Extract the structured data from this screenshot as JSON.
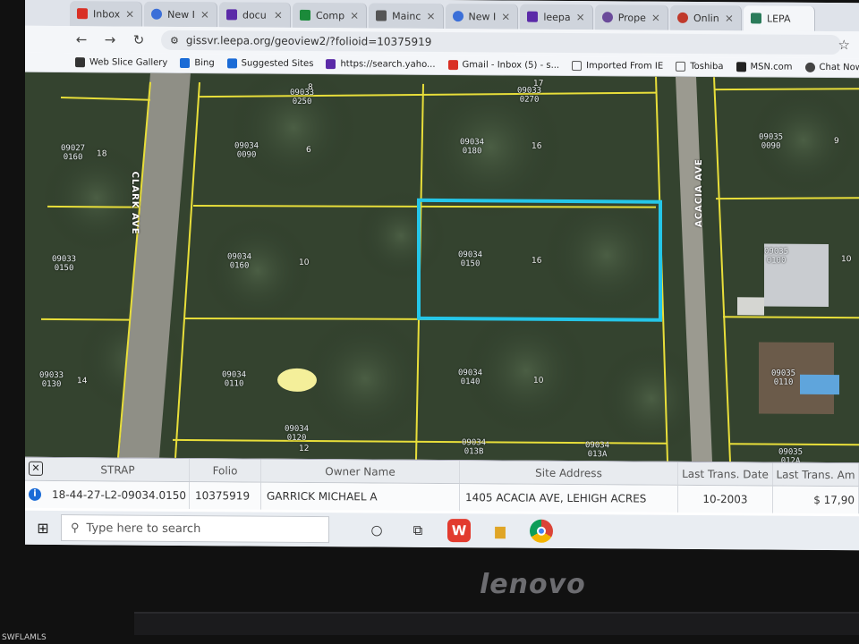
{
  "browser": {
    "tabs": [
      {
        "label": "Inbox",
        "color": "#d93025"
      },
      {
        "label": "New I",
        "color": "#3b6fd8"
      },
      {
        "label": "docu",
        "color": "#5b2aa8"
      },
      {
        "label": "Comp",
        "color": "#1b8a3a"
      },
      {
        "label": "Mainc",
        "color": "#555555"
      },
      {
        "label": "New I",
        "color": "#3b6fd8"
      },
      {
        "label": "leepa",
        "color": "#5b2aa8"
      },
      {
        "label": "Prope",
        "color": "#6b4b9a"
      },
      {
        "label": "Onlin",
        "color": "#c0392b"
      },
      {
        "label": "LEPA",
        "color": "#2a7b5a",
        "active": true
      }
    ],
    "url": "gissvr.leepa.org/geoview2/?folioid=10375919",
    "bookmarks": [
      {
        "label": "Web Slice Gallery",
        "color": "#333333"
      },
      {
        "label": "Bing",
        "color": "#1a6bd6"
      },
      {
        "label": "Suggested Sites",
        "color": "#1a6bd6"
      },
      {
        "label": "https://search.yaho...",
        "color": "#5b2aa8"
      },
      {
        "label": "Gmail - Inbox (5) - s...",
        "color": "#d93025"
      },
      {
        "label": "Imported From IE",
        "color": "#555555"
      },
      {
        "label": "Toshiba",
        "color": "#555555"
      },
      {
        "label": "MSN.com",
        "color": "#222222"
      },
      {
        "label": "Chat Now Button",
        "color": "#444444"
      }
    ]
  },
  "map": {
    "streets": [
      "CLARK AVE",
      "ACACIA AVE"
    ],
    "parcels": [
      {
        "id": "09034\n0150",
        "lot": "16"
      },
      {
        "id": "09034\n0160",
        "lot": "10"
      },
      {
        "id": "09034\n0140",
        "lot": "10"
      },
      {
        "id": "09034\n0180",
        "lot": "16"
      },
      {
        "id": "09034\n0090",
        "lot": "6"
      },
      {
        "id": "09034\n0110",
        "lot": ""
      },
      {
        "id": "09034\n0120",
        "lot": "12"
      },
      {
        "id": "09034\n013B",
        "lot": ""
      },
      {
        "id": "09034\n013A",
        "lot": ""
      },
      {
        "id": "09035\n0100",
        "lot": "10"
      },
      {
        "id": "09035\n0110",
        "lot": ""
      },
      {
        "id": "09035\n012A",
        "lot": ""
      },
      {
        "id": "09035\n0090",
        "lot": "9"
      },
      {
        "id": "09033\n0150",
        "lot": ""
      },
      {
        "id": "09033\n0130",
        "lot": "14"
      },
      {
        "id": "09027\n0160",
        "lot": "18"
      },
      {
        "id": "09033\n0270",
        "lot": "17"
      },
      {
        "id": "09033\n0250",
        "lot": "8"
      }
    ],
    "highlight_color": "#25c6e8",
    "line_color": "#e8de3a"
  },
  "table": {
    "headers": [
      "STRAP",
      "Folio",
      "Owner Name",
      "Site Address",
      "Last Trans. Date",
      "Last Trans. Am"
    ],
    "row": [
      "18-44-27-L2-09034.0150",
      "10375919",
      "GARRICK MICHAEL A",
      "1405 ACACIA AVE, LEHIGH ACRES",
      "10-2003",
      "$ 17,90"
    ]
  },
  "taskbar": {
    "search_placeholder": "Type here to search"
  },
  "hardware": {
    "brand": "lenovo",
    "corner_mark": "SWFLAMLS"
  }
}
